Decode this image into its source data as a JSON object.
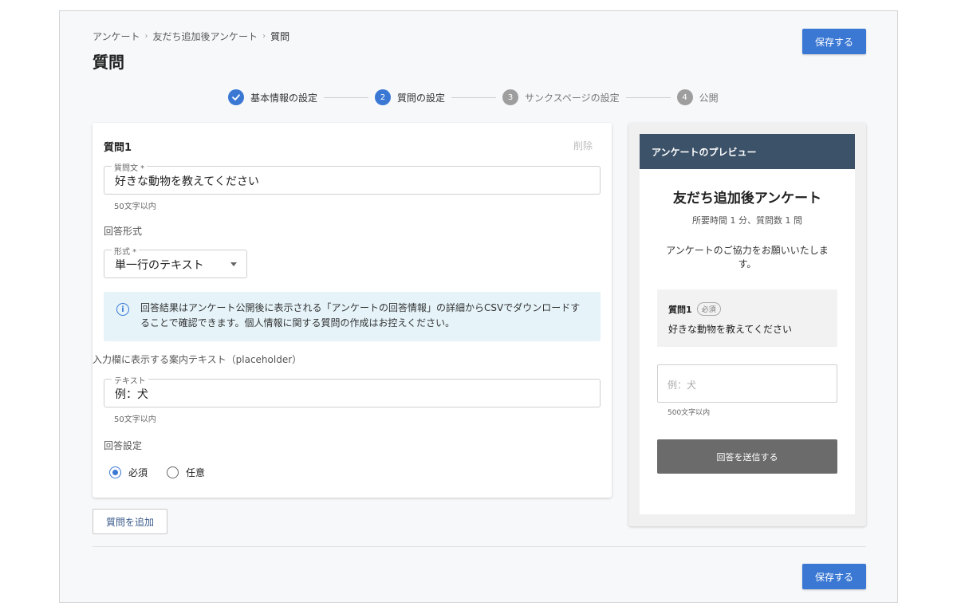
{
  "breadcrumb": [
    "アンケート",
    "友だち追加後アンケート",
    "質問"
  ],
  "breadcrumb_separator": "›",
  "page_title": "質問",
  "save_label": "保存する",
  "stepper": {
    "steps": [
      {
        "number": "✓",
        "label": "基本情報の設定",
        "state": "done"
      },
      {
        "number": "2",
        "label": "質問の設定",
        "state": "active"
      },
      {
        "number": "3",
        "label": "サンクスページの設定",
        "state": "inactive"
      },
      {
        "number": "4",
        "label": "公開",
        "state": "inactive"
      }
    ]
  },
  "question": {
    "title": "質問1",
    "delete_label": "削除",
    "text_field": {
      "legend": "質問文 *",
      "value": "好きな動物を教えてください",
      "helper": "50文字以内"
    },
    "answer_format_label": "回答形式",
    "format_field": {
      "legend": "形式 *",
      "value": "単一行のテキスト"
    },
    "info_icon": "i",
    "info_text": "回答結果はアンケート公開後に表示される「アンケートの回答情報」の詳細からCSVでダウンロードすることで確認できます。個人情報に関する質問の作成はお控えください。",
    "placeholder_label": "入力欄に表示する案内テキスト（placeholder）",
    "placeholder_field": {
      "legend": "テキスト",
      "value": "例：犬",
      "helper": "50文字以内"
    },
    "answer_setting_label": "回答設定",
    "radio_required": "必須",
    "radio_optional": "任意",
    "selected": "required"
  },
  "add_question_label": "質問を追加",
  "preview": {
    "header": "アンケートのプレビュー",
    "title": "友だち追加後アンケート",
    "subtitle": "所要時間 1 分、質問数 1 問",
    "description": "アンケートのご協力をお願いいたします。",
    "question_label": "質問1",
    "badge": "必須",
    "question_text": "好きな動物を教えてください",
    "input_placeholder": "例：犬",
    "helper": "500文字以内",
    "submit_label": "回答を送信する"
  },
  "colors": {
    "accent": "#3a78d4",
    "preview_header": "#3c5269",
    "info_bg": "#e6f4fa"
  }
}
